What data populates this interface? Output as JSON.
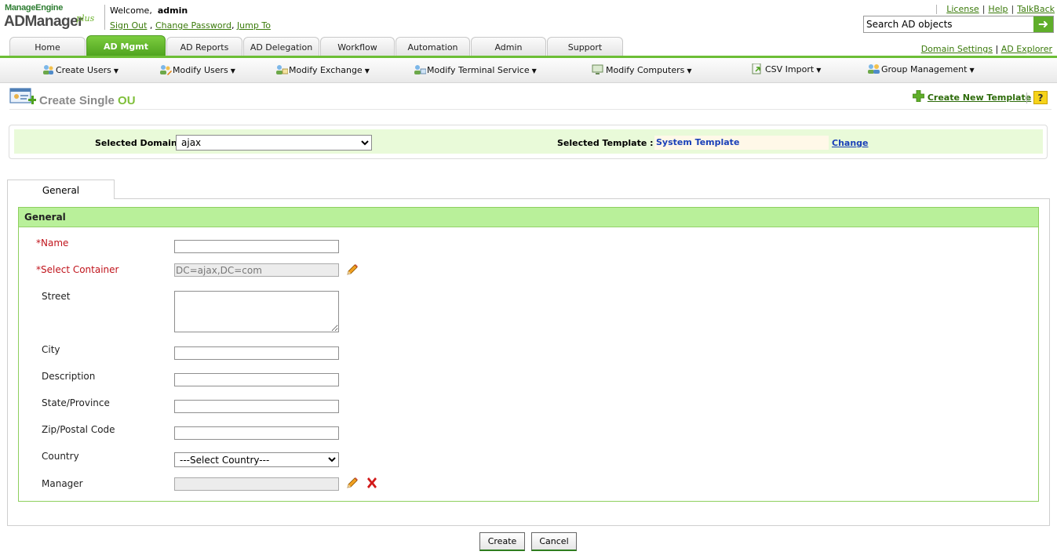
{
  "brand": {
    "top": "ManageEngine",
    "main": "ADManager",
    "plus": "plus"
  },
  "header": {
    "welcome_prefix": "Welcome,",
    "username": "admin",
    "sign_out": "Sign Out",
    "change_password": "Change Password",
    "jump_to": "Jump To",
    "links": {
      "license": "License",
      "help": "Help",
      "talkback": "TalkBack"
    },
    "search": {
      "value": "Search AD objects"
    }
  },
  "tabs": [
    {
      "label": "Home"
    },
    {
      "label": "AD Mgmt",
      "active": true
    },
    {
      "label": "AD Reports"
    },
    {
      "label": "AD Delegation"
    },
    {
      "label": "Workflow"
    },
    {
      "label": "Automation"
    },
    {
      "label": "Admin"
    },
    {
      "label": "Support"
    }
  ],
  "right_links": {
    "domain_settings": "Domain Settings",
    "ad_explorer": "AD Explorer"
  },
  "submenu": [
    {
      "label": "Create Users",
      "icon": "users-create-icon"
    },
    {
      "label": "Modify Users",
      "icon": "users-modify-icon"
    },
    {
      "label": "Modify Exchange",
      "icon": "exchange-icon"
    },
    {
      "label": "Modify Terminal Service",
      "icon": "terminal-service-icon"
    },
    {
      "label": "Modify Computers",
      "icon": "computer-icon"
    },
    {
      "label": "CSV Import",
      "icon": "csv-import-icon"
    },
    {
      "label": "Group Management",
      "icon": "group-icon"
    }
  ],
  "page": {
    "title_prefix": "Create Single",
    "title_highlight": "OU",
    "create_new_template": "Create New Template",
    "help": "?"
  },
  "domain_bar": {
    "domain_label": "Selected Domain:",
    "domain_value": "ajax",
    "template_label": "Selected Template :",
    "template_value": "System Template",
    "change": "Change"
  },
  "section": {
    "tab_label": "General",
    "header": "General",
    "fields": {
      "name": {
        "label": "Name",
        "required": true,
        "value": ""
      },
      "container": {
        "label": "Select Container",
        "required": true,
        "value": "DC=ajax,DC=com"
      },
      "street": {
        "label": "Street",
        "value": ""
      },
      "city": {
        "label": "City",
        "value": ""
      },
      "description": {
        "label": "Description",
        "value": ""
      },
      "state": {
        "label": "State/Province",
        "value": ""
      },
      "zip": {
        "label": "Zip/Postal Code",
        "value": ""
      },
      "country": {
        "label": "Country",
        "value": "---Select Country---"
      },
      "manager": {
        "label": "Manager",
        "value": ""
      }
    },
    "required_mark": "*"
  },
  "buttons": {
    "create": "Create",
    "cancel": "Cancel"
  },
  "colors": {
    "accent_green": "#5fae2a",
    "header_green": "#b9f09a",
    "required_red": "#c0141c",
    "template_blue": "#1a40b8"
  }
}
